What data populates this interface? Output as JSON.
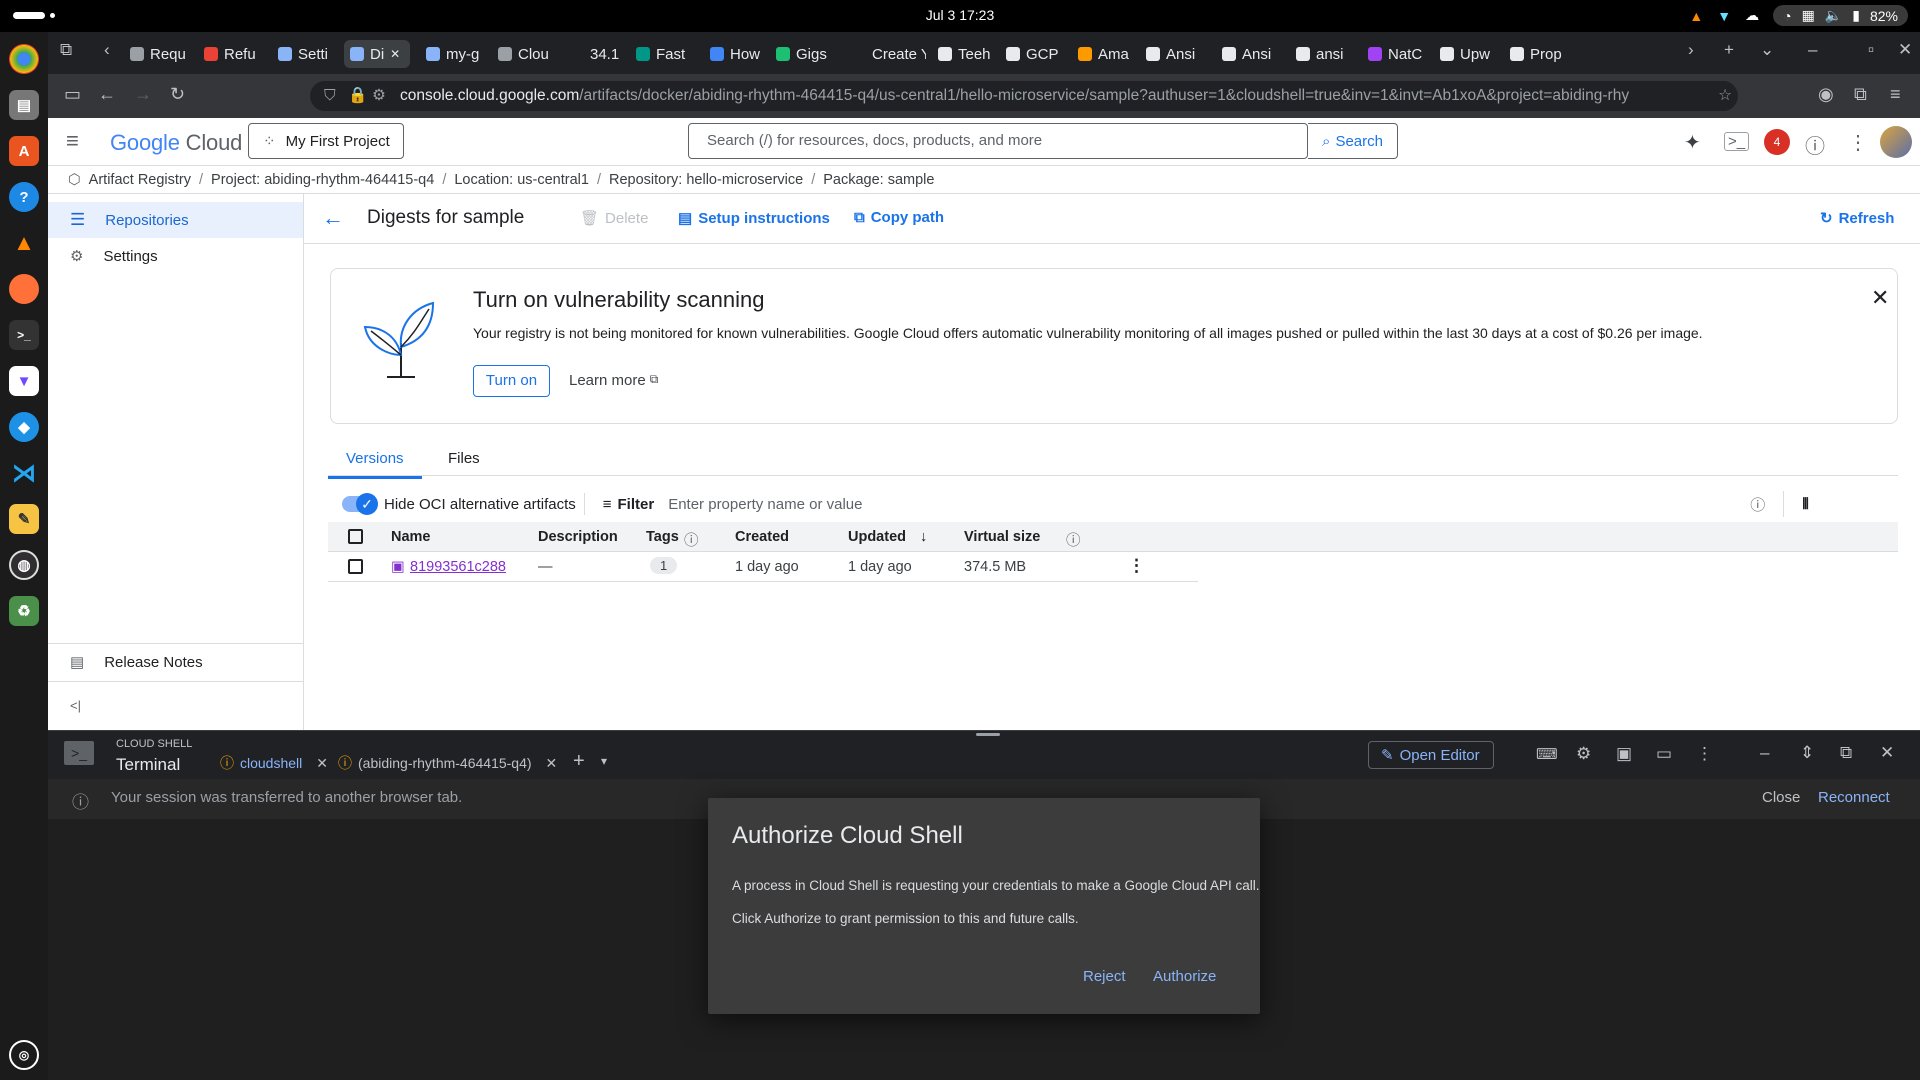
{
  "system": {
    "clock": "Jul 3  17:23",
    "battery": "82%"
  },
  "browser": {
    "tabs": [
      {
        "label": "Requ",
        "color": "#9aa0a6"
      },
      {
        "label": "Refu",
        "color": "#ea4335"
      },
      {
        "label": "Setti",
        "color": "#8ab4f8"
      },
      {
        "label": "Di",
        "color": "#8ab4f8"
      },
      {
        "label": "my-g",
        "color": "#8ab4f8"
      },
      {
        "label": "Clou",
        "color": "#9aa0a6"
      },
      {
        "label": "34.1",
        "color": "#202124"
      },
      {
        "label": "Fast",
        "color": "#009688"
      },
      {
        "label": "How",
        "color": "#4285f4"
      },
      {
        "label": "Gigs",
        "color": "#1dbf73"
      },
      {
        "label": "Create Y",
        "color": "#202124"
      },
      {
        "label": "Teeh",
        "color": "#e8eaed"
      },
      {
        "label": "GCP",
        "color": "#e8eaed"
      },
      {
        "label": "Ama",
        "color": "#ff9900"
      },
      {
        "label": "Ansi",
        "color": "#e8eaed"
      },
      {
        "label": "Ansi",
        "color": "#e8eaed"
      },
      {
        "label": "ansi",
        "color": "#e8eaed"
      },
      {
        "label": "NatC",
        "color": "#a142f4"
      },
      {
        "label": "Upw",
        "color": "#e8eaed"
      },
      {
        "label": "Prop",
        "color": "#e8eaed"
      }
    ],
    "url_host": "console.cloud.google.com",
    "url_path": "/artifacts/docker/abiding-rhythm-464415-q4/us-central1/hello-microservice/sample?authuser=1&cloudshell=true&inv=1&invt=Ab1xoA&project=abiding-rhy"
  },
  "header": {
    "logo": {
      "google": "Google",
      "cloud": "Cloud"
    },
    "project": "My First Project",
    "search_placeholder": "Search (/) for resources, docs, products, and more",
    "search_button": "Search",
    "notifications": "4"
  },
  "breadcrumb": {
    "root": "Artifact Registry",
    "project": "Project: abiding-rhythm-464415-q4",
    "location": "Location: us-central1",
    "repository": "Repository: hello-microservice",
    "package": "Package: sample"
  },
  "sidebar": {
    "items": [
      {
        "label": "Repositories"
      },
      {
        "label": "Settings"
      }
    ],
    "release_notes": "Release Notes",
    "collapse": "<|"
  },
  "toolbar": {
    "title": "Digests for sample",
    "delete": "Delete",
    "setup": "Setup instructions",
    "copy_path": "Copy path",
    "refresh": "Refresh"
  },
  "banner": {
    "title": "Turn on vulnerability scanning",
    "body": "Your registry is not being monitored for known vulnerabilities. Google Cloud offers automatic vulnerability monitoring of all images pushed or pulled within the last 30 days at a cost of $0.26 per image.",
    "turn_on": "Turn on",
    "learn_more": "Learn more"
  },
  "tabs": {
    "versions": "Versions",
    "files": "Files"
  },
  "filter": {
    "toggle_label": "Hide OCI alternative artifacts",
    "filter_label": "Filter",
    "placeholder": "Enter property name or value"
  },
  "table": {
    "columns": {
      "name": "Name",
      "description": "Description",
      "tags": "Tags",
      "created": "Created",
      "updated": "Updated",
      "virtual_size": "Virtual size"
    },
    "rows": [
      {
        "name": "81993561c288",
        "description": "—",
        "tags": "1",
        "created": "1 day ago",
        "updated": "1 day ago",
        "size": "374.5 MB"
      }
    ]
  },
  "shell": {
    "section": "CLOUD SHELL",
    "title": "Terminal",
    "tab1": "cloudshell",
    "tab2": "(abiding-rhythm-464415-q4)",
    "open_editor": "Open Editor",
    "info": "Your session was transferred to another browser tab.",
    "close": "Close",
    "reconnect": "Reconnect"
  },
  "dialog": {
    "title": "Authorize Cloud Shell",
    "p1": "A process in Cloud Shell is requesting your credentials to make a Google Cloud API call.",
    "p2": "Click Authorize to grant permission to this and future calls.",
    "reject": "Reject",
    "authorize": "Authorize"
  }
}
